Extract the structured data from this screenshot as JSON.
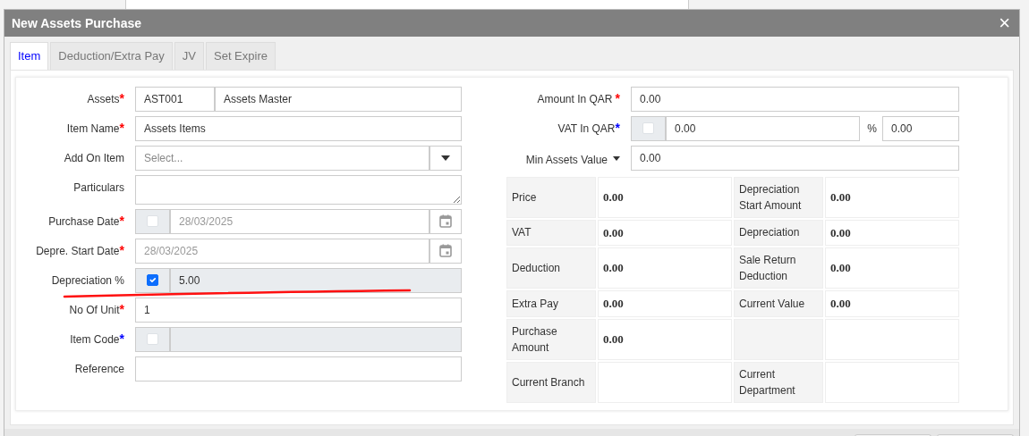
{
  "window": {
    "title": "New Assets Purchase",
    "close": "×"
  },
  "tabs": [
    {
      "label": "Item",
      "selected": true
    },
    {
      "label": "Deduction/Extra Pay",
      "selected": false
    },
    {
      "label": "JV",
      "selected": false
    },
    {
      "label": "Set Expire",
      "selected": false
    }
  ],
  "left_fields": [
    {
      "kind": "pair",
      "label": "Assets",
      "marker": {
        "text": "*",
        "color": "#ff0000"
      },
      "value": "AST001",
      "value_2": "Assets Master"
    },
    {
      "kind": "text",
      "label": "Item Name",
      "marker": {
        "text": "*",
        "color": "#ff0000"
      },
      "value": "Assets Items"
    },
    {
      "kind": "select",
      "label": "Add On Item",
      "placeholder": "Select..."
    },
    {
      "kind": "textarea",
      "label": "Particulars"
    },
    {
      "kind": "check_date",
      "label": "Purchase Date",
      "marker": {
        "text": "*",
        "color": "#ff0000"
      },
      "checked": false,
      "value": "28/03/2025",
      "disabled": true
    },
    {
      "kind": "date",
      "label": "Depre. Start Date",
      "marker": {
        "text": "*",
        "color": "#ff0000"
      },
      "value": "28/03/2025",
      "disabled": true
    },
    {
      "kind": "check_text",
      "label": "Depreciation %",
      "checked": true,
      "value": "5.00",
      "readonly": true
    },
    {
      "kind": "text",
      "label": "No Of Unit",
      "marker": {
        "text": "*",
        "color": "#ff0000"
      },
      "value": "1"
    },
    {
      "kind": "check_text",
      "label": "Item Code",
      "marker": {
        "text": "*",
        "color": "#0000ff"
      },
      "checked": false,
      "readonly": true
    },
    {
      "kind": "text",
      "label": "Reference"
    }
  ],
  "right_fields": [
    {
      "kind": "text",
      "label": "Amount In QAR",
      "marker": {
        "text": "*",
        "color": "#ff0000"
      },
      "value": "0.00"
    },
    {
      "kind": "check_percent",
      "label": "VAT In QAR",
      "marker": {
        "text": "*",
        "color": "#0000ff"
      },
      "checked": false,
      "value": "0.00",
      "unit": "%",
      "value_2": "0.00"
    },
    {
      "kind": "dropdown_label",
      "label": "Min Assets Value",
      "value": "0.00"
    }
  ],
  "summary_table": [
    {
      "label": "Price",
      "value": "0.00",
      "label_2": "Depreciation Start Amount",
      "value_2": "0.00"
    },
    {
      "label": "VAT",
      "value": "0.00",
      "label_2": "Depreciation",
      "value_2": "0.00"
    },
    {
      "label": "Deduction",
      "value": "0.00",
      "label_2": "Sale Return Deduction",
      "value_2": "0.00"
    },
    {
      "label": "Extra Pay",
      "value": "0.00",
      "label_2": "Current Value",
      "value_2": "0.00"
    },
    {
      "label": "Purchase Amount",
      "value": "0.00"
    },
    {
      "label": "Current Branch",
      "label_2": "Current Department"
    }
  ]
}
